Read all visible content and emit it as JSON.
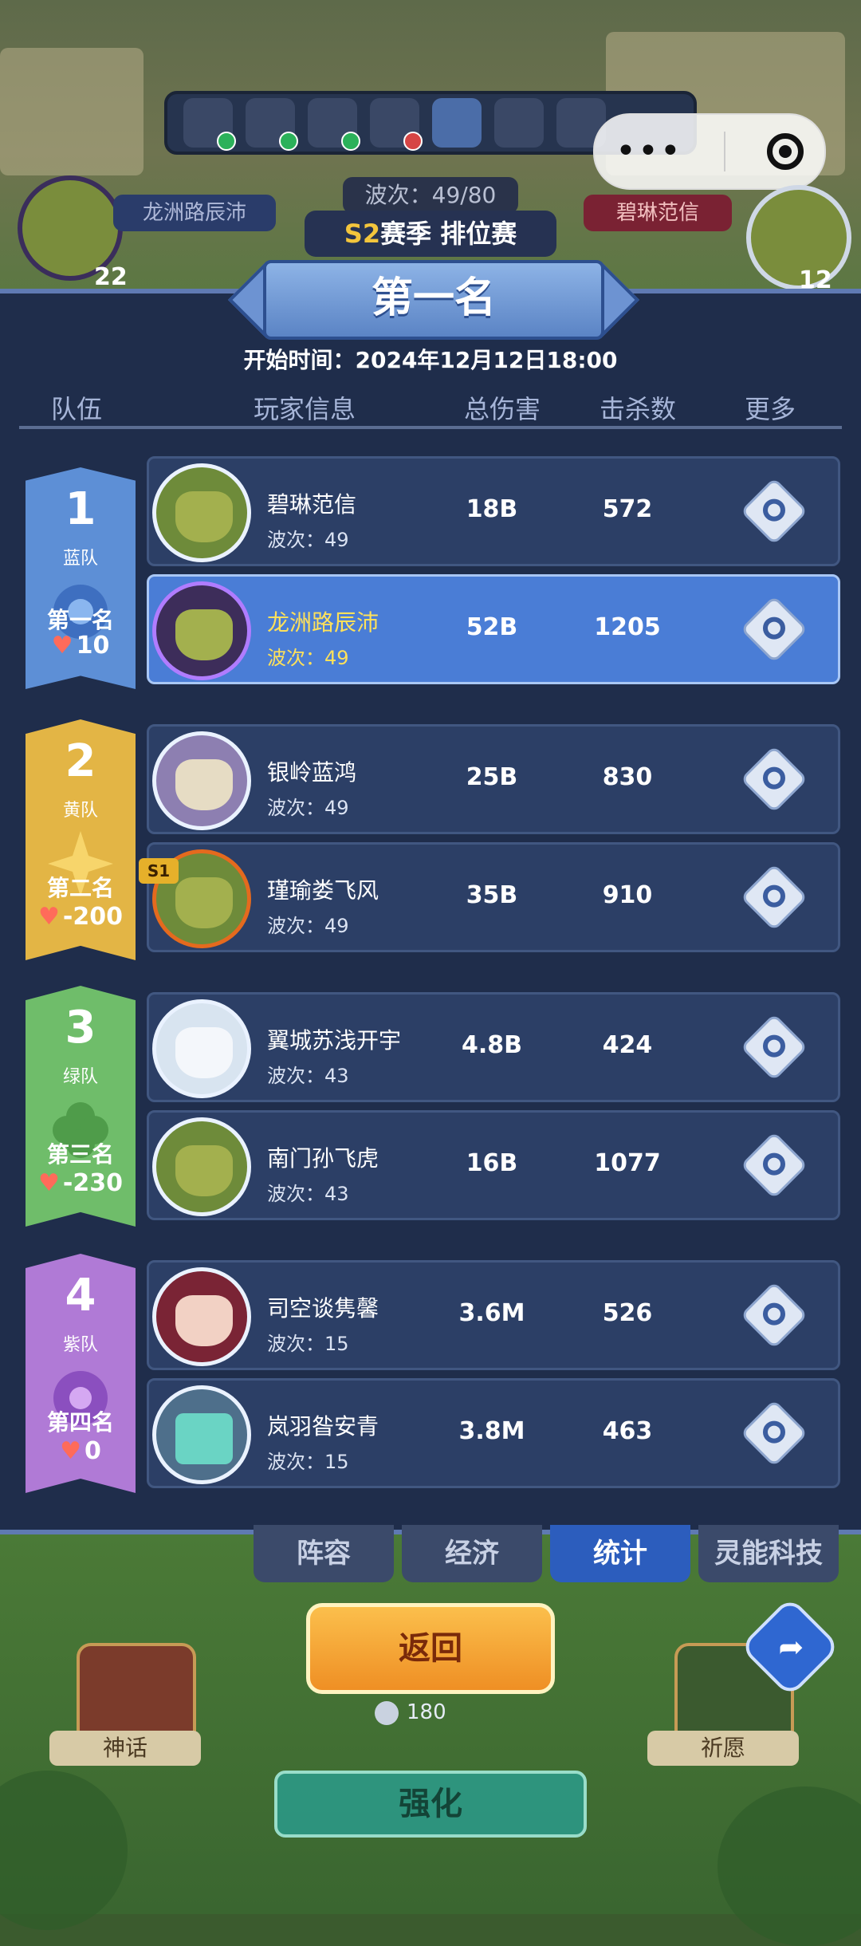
{
  "hud": {
    "wave_label": "波次：49/80",
    "season_prefix": "S2",
    "season_label": "赛季 排位赛",
    "left_player": "龙洲路辰沛",
    "right_player": "碧琳范信",
    "left_level": "22",
    "right_level": "12"
  },
  "panel": {
    "title": "第一名",
    "start_time": "开始时间：2024年12月12日18:00",
    "headers": {
      "team": "队伍",
      "player": "玩家信息",
      "damage": "总伤害",
      "kills": "击杀数",
      "more": "更多"
    },
    "teams": [
      {
        "num": "1",
        "name": "蓝队",
        "rank": "第一名",
        "score": "10",
        "color": "#5d8fd6"
      },
      {
        "num": "2",
        "name": "黄队",
        "rank": "第二名",
        "score": "-200",
        "color": "#e3b545"
      },
      {
        "num": "3",
        "name": "绿队",
        "rank": "第三名",
        "score": "-230",
        "color": "#6fbd6a"
      },
      {
        "num": "4",
        "name": "紫队",
        "rank": "第四名",
        "score": "0",
        "color": "#b07ad6"
      }
    ],
    "players": [
      {
        "name": "碧琳范信",
        "wave": "波次：49",
        "damage": "18B",
        "kills": "572",
        "highlight": false
      },
      {
        "name": "龙洲路辰沛",
        "wave": "波次：49",
        "damage": "52B",
        "kills": "1205",
        "highlight": true
      },
      {
        "name": "银岭蓝鸿",
        "wave": "波次：49",
        "damage": "25B",
        "kills": "830",
        "highlight": false
      },
      {
        "name": "瑾瑜娄飞风",
        "wave": "波次：49",
        "damage": "35B",
        "kills": "910",
        "highlight": false
      },
      {
        "name": "翼城苏浅开宇",
        "wave": "波次：43",
        "damage": "4.8B",
        "kills": "424",
        "highlight": false
      },
      {
        "name": "南门孙飞虎",
        "wave": "波次：43",
        "damage": "16B",
        "kills": "1077",
        "highlight": false
      },
      {
        "name": "司空谈隽馨",
        "wave": "波次：15",
        "damage": "3.6M",
        "kills": "526",
        "highlight": false
      },
      {
        "name": "岚羽昝安青",
        "wave": "波次：15",
        "damage": "3.8M",
        "kills": "463",
        "highlight": false
      }
    ],
    "badge_s1": "S1"
  },
  "tabs": [
    "阵容",
    "经济",
    "统计",
    "灵能科技"
  ],
  "active_tab": "统计",
  "bottom": {
    "back_label": "返回",
    "coins": "180",
    "myth_label": "神话",
    "wish_label": "祈愿",
    "strengthen_label": "强化"
  }
}
